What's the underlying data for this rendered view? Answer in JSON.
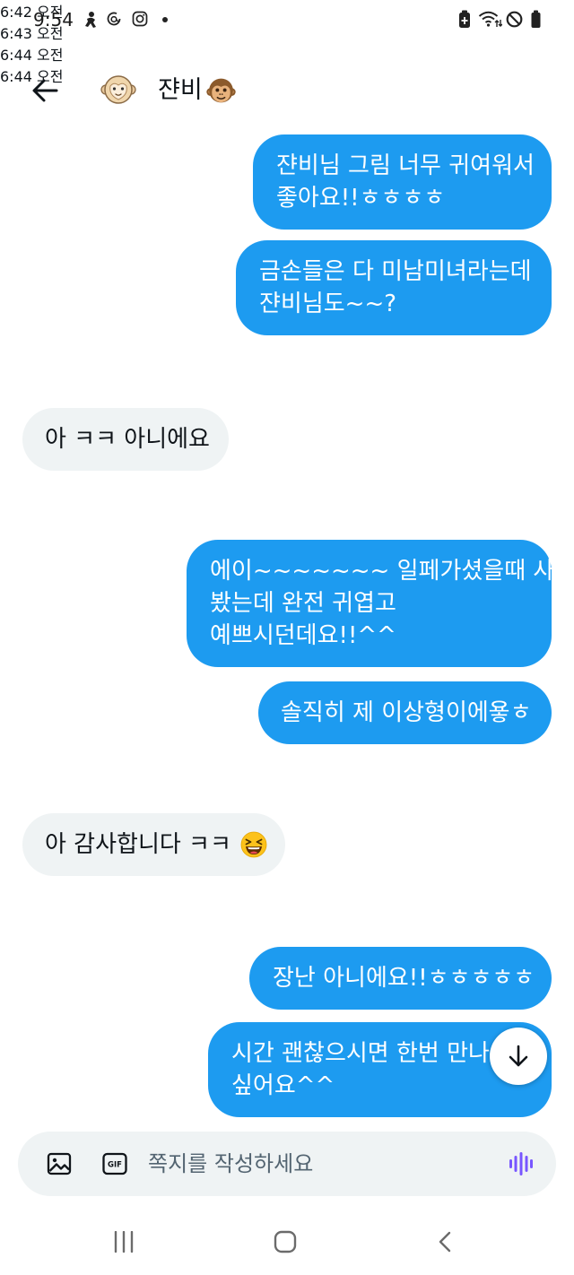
{
  "status_bar": {
    "time": "9:54",
    "icons": [
      "app-notification-icon",
      "threads-icon",
      "instagram-icon",
      "notification-dot-icon",
      "battery-saver-icon",
      "wifi-icon",
      "do-not-disturb-icon",
      "battery-icon"
    ]
  },
  "header": {
    "back_icon": "arrow-left-icon",
    "avatar_icon": "monkey-avatar",
    "name": "쟌비",
    "name_emoji_icon": "monkey-face-icon"
  },
  "conversation": {
    "messages": [
      {
        "outgoing": true,
        "lines": [
          "쟌비님 그림 너무 귀여워서",
          "좋아요!!ㅎㅎㅎㅎ"
        ]
      },
      {
        "outgoing": true,
        "lines": [
          "금손들은 다 미남미녀라는데",
          "쟌비님도~~?"
        ]
      },
      {
        "outgoing": false,
        "lines": [
          "아 ㅋㅋ 아니에요"
        ]
      },
      {
        "outgoing": true,
        "lines": [
          "에이~~~~~~~ 일페가셨을때 사진",
          "봤는데 완전 귀엽고",
          "예쁘시던데요!!^^"
        ]
      },
      {
        "outgoing": true,
        "lines": [
          "솔직히 제 이상형이에욯ㅎ"
        ]
      },
      {
        "outgoing": false,
        "lines": [
          "아 감사합니다 ㅋㅋ"
        ],
        "emoji_icon": "grinning-squinting-face-icon"
      },
      {
        "outgoing": true,
        "lines": [
          "장난 아니에요!!ㅎㅎㅎㅎㅎ"
        ]
      },
      {
        "outgoing": true,
        "lines": [
          "시간 괜찮으시면 한번 만나고",
          "싶어요^^"
        ]
      }
    ],
    "timestamps": [
      "6:42 오전",
      "6:43 오전",
      "6:44 오전",
      "6:44 오전"
    ]
  },
  "scroll_button": {
    "icon": "arrow-down-icon"
  },
  "composer": {
    "placeholder": "쪽지를 작성하세요",
    "image_icon": "image-icon",
    "gif_label": "GIF",
    "voice_icon": "voice-waveform-icon"
  },
  "nav_bar": {
    "icons": [
      "recent-apps-icon",
      "home-icon",
      "back-icon"
    ]
  },
  "colors": {
    "accent": "#1d9bf0",
    "received_bubble": "#eff3f4",
    "text": "#0f1419",
    "secondary_text": "#536471",
    "voice": "#7856ff"
  }
}
